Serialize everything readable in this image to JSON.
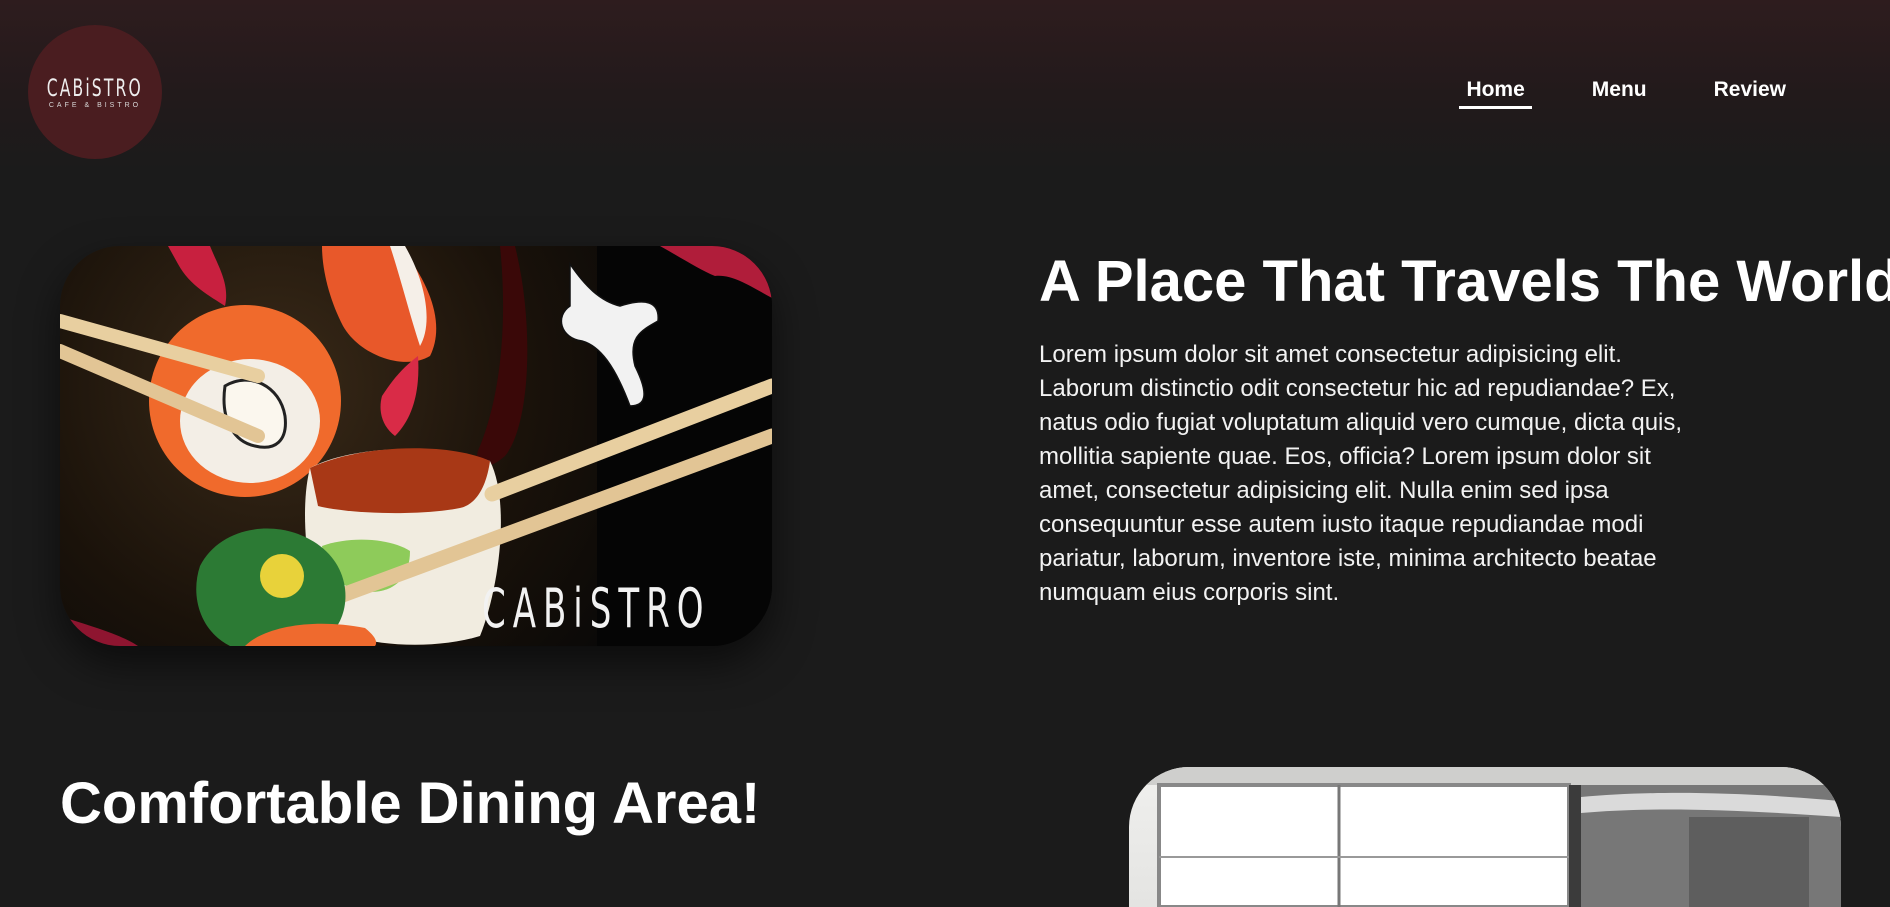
{
  "header": {
    "logo": {
      "name": "CABiSTRO",
      "tagline": "CAFE & BISTRO"
    },
    "nav": [
      {
        "label": "Home",
        "active": true
      },
      {
        "label": "Menu",
        "active": false
      },
      {
        "label": "Review",
        "active": false
      }
    ]
  },
  "hero": {
    "image": {
      "brand_text": "CABiSTRO"
    },
    "title": "A Place That Travels The World!",
    "description": "Lorem ipsum dolor sit amet consectetur adipisicing elit. Laborum distinctio odit consectetur hic ad repudiandae? Ex, natus odio fugiat voluptatum aliquid vero cumque, dicta quis, mollitia sapiente quae. Eos, officia? Lorem ipsum dolor sit amet, consectetur adipisicing elit. Nulla enim sed ipsa consequuntur esse autem iusto itaque repudiandae modi pariatur, laborum, inventore iste, minima architecto beatae numquam eius corporis sint."
  },
  "section2": {
    "title": "Comfortable Dining Area!"
  },
  "colors": {
    "background": "#1b1b1b",
    "header_top": "#2e1c1e",
    "logo_circle": "#4a1d20",
    "text": "#ffffff",
    "sauce_red": "#b01d3a"
  }
}
